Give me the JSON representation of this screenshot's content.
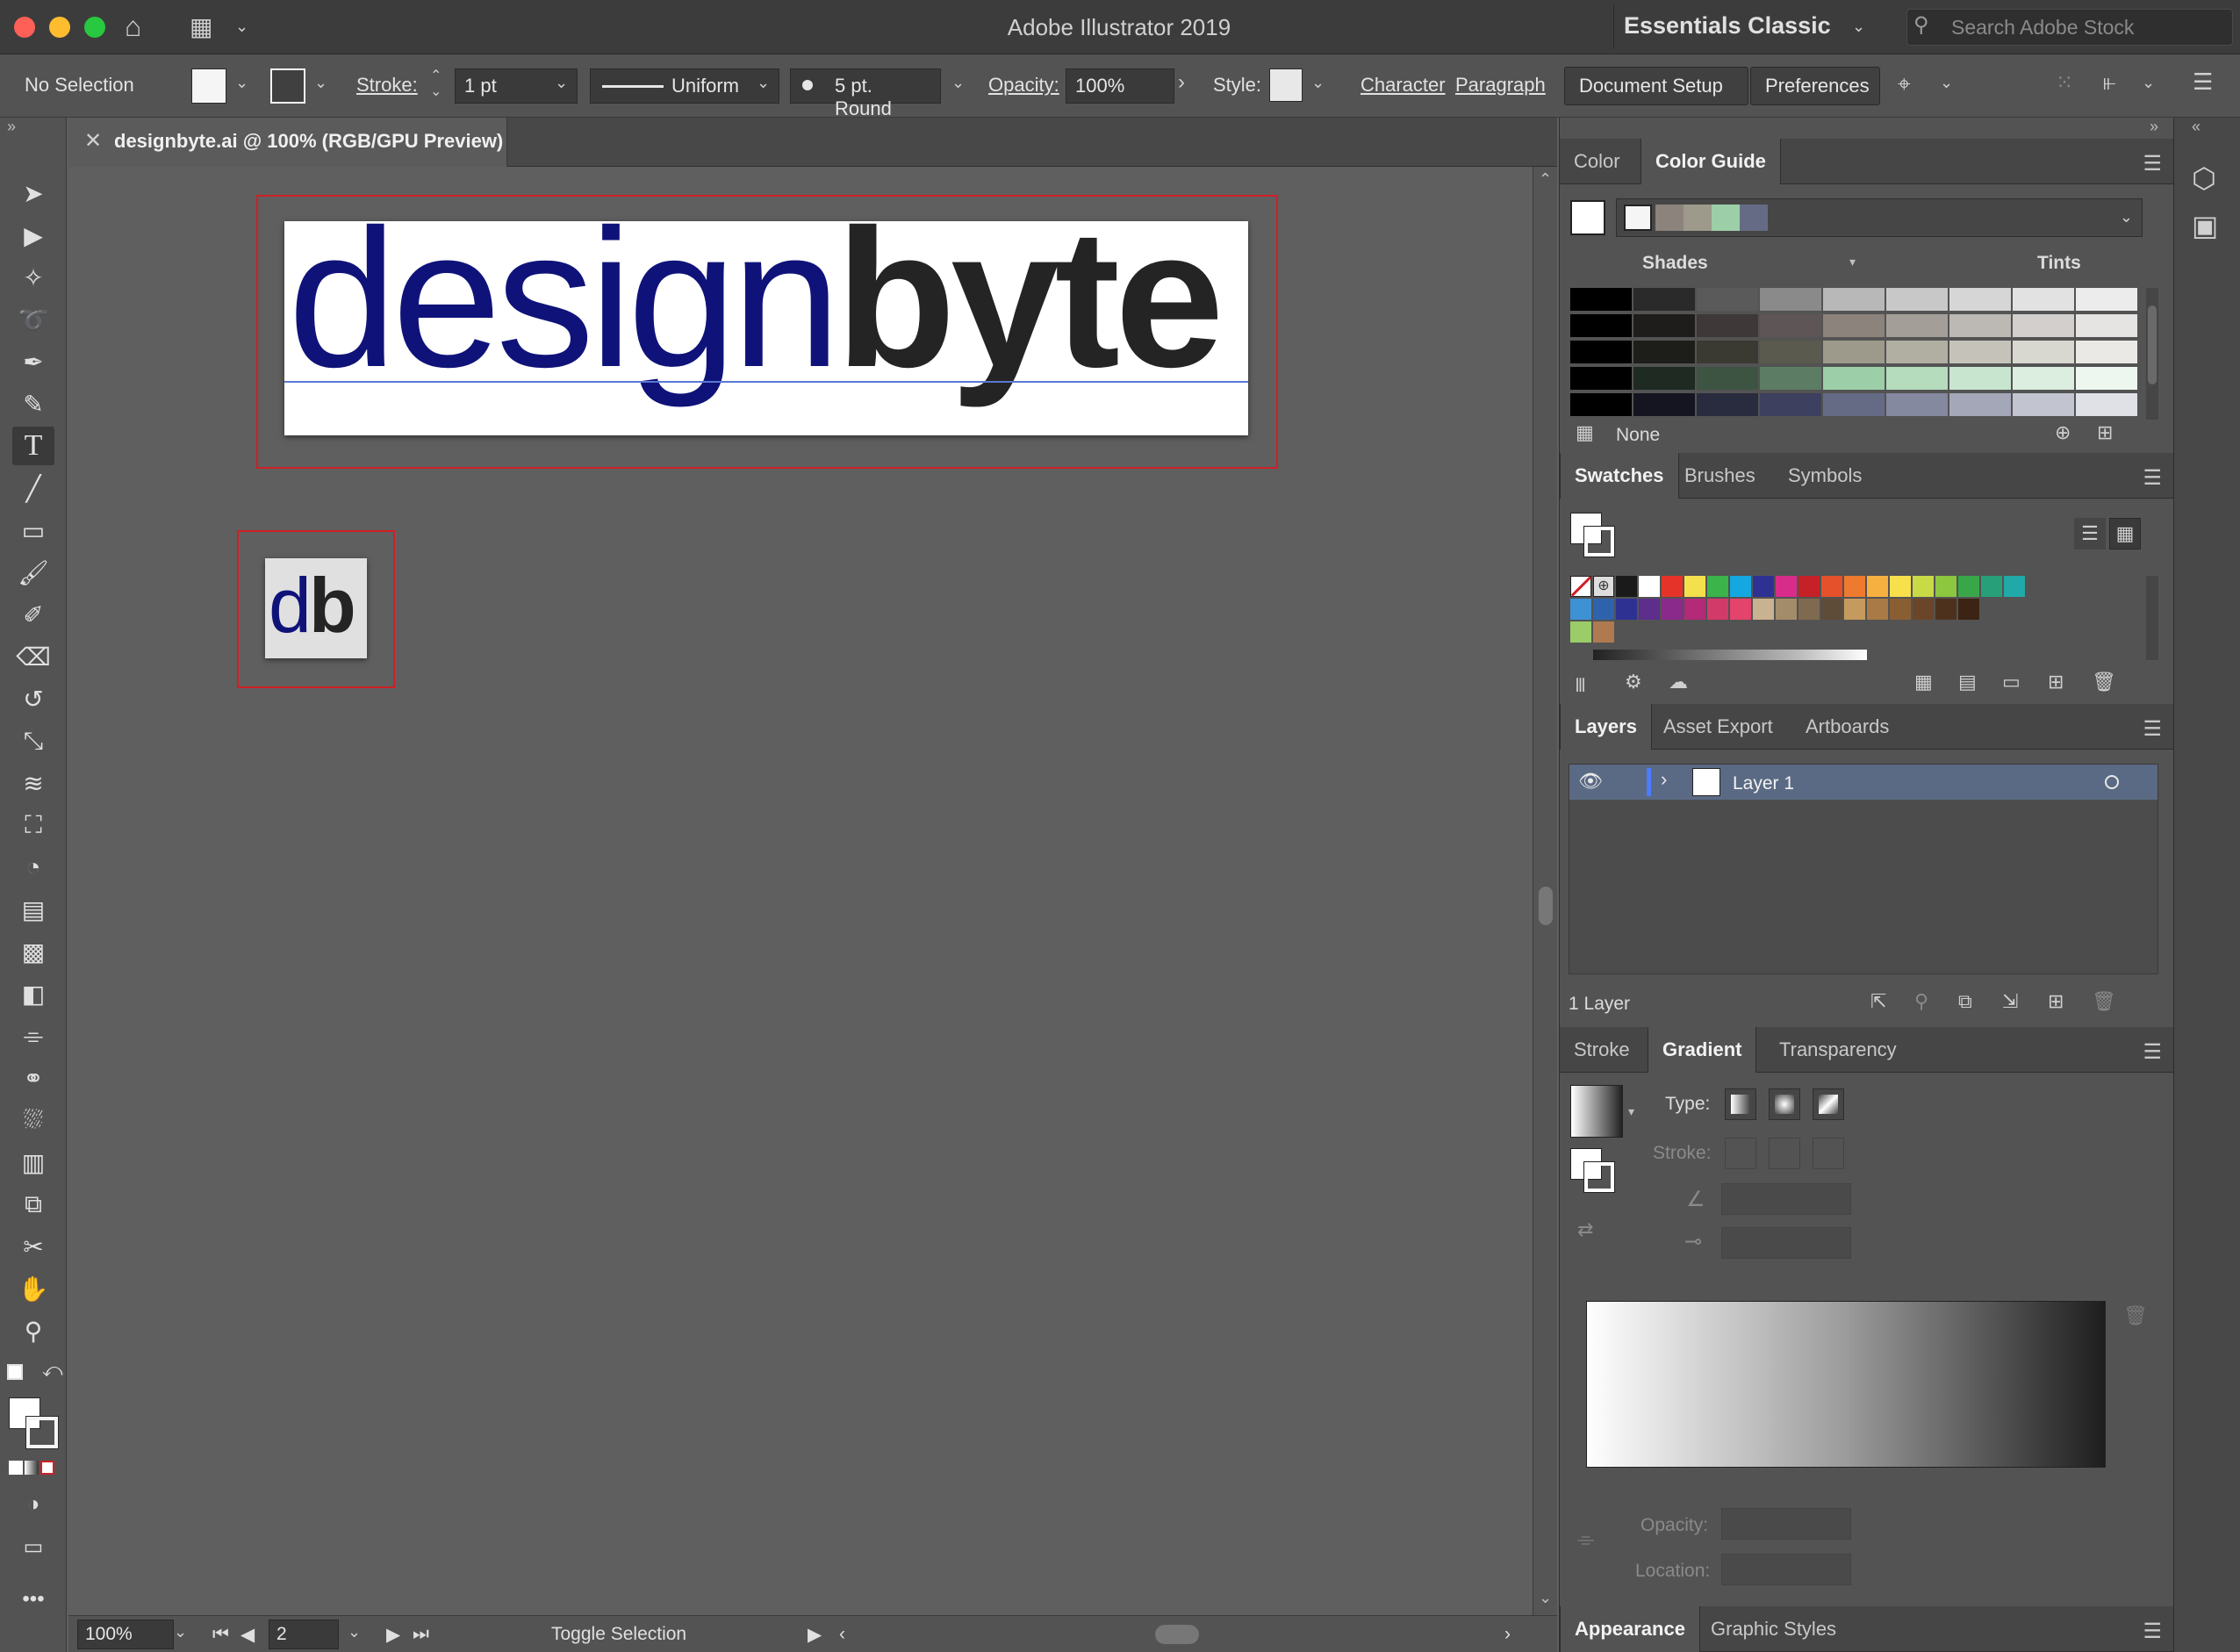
{
  "titlebar": {
    "app_title": "Adobe Illustrator 2019",
    "workspace": "Essentials Classic",
    "stock_search_placeholder": "Search Adobe Stock"
  },
  "controlbar": {
    "selection": "No Selection",
    "stroke_label": "Stroke:",
    "stroke_weight": "1 pt",
    "profile": "Uniform",
    "brush": "5 pt. Round",
    "opacity_label": "Opacity:",
    "opacity_value": "100%",
    "style_label": "Style:",
    "character": "Character",
    "paragraph": "Paragraph",
    "document_setup": "Document Setup",
    "preferences": "Preferences"
  },
  "document": {
    "tab_label": "designbyte.ai @ 100% (RGB/GPU Preview)",
    "logo_part1": "design",
    "logo_part2": "byte",
    "icon_part1": "d",
    "icon_part2": "b"
  },
  "statusbar": {
    "zoom": "100%",
    "artboard": "2",
    "status": "Toggle Selection"
  },
  "colorguide": {
    "tab_color": "Color",
    "tab_color_guide": "Color Guide",
    "shades": "Shades",
    "tints": "Tints",
    "none": "None",
    "harmony_colors": [
      "#f5f5f5",
      "#8b837c",
      "#9d9a8b",
      "#9ccfa8",
      "#666b85"
    ],
    "grid": [
      [
        "#000000",
        "#2a2a2a",
        "#5a5a5a",
        "#8a8a8a",
        "#b8b8b8",
        "#c8c8c8",
        "#d6d6d6",
        "#e2e2e2",
        "#ececec"
      ],
      [
        "#000000",
        "#1f1c1c",
        "#3e3838",
        "#5e5656",
        "#8b837c",
        "#a49e99",
        "#bcb8b4",
        "#d2cfcc",
        "#e6e4e2"
      ],
      [
        "#000000",
        "#1d1d1a",
        "#3a3a33",
        "#5a5a4f",
        "#9d9a8b",
        "#b1aea2",
        "#c5c3b9",
        "#d8d7d0",
        "#eae9e5"
      ],
      [
        "#000000",
        "#1e2a22",
        "#3d5443",
        "#5c7d64",
        "#9ccfa8",
        "#b4dcbd",
        "#c8e5cf",
        "#dbeee0",
        "#edf7ef"
      ],
      [
        "#000000",
        "#141520",
        "#292b3f",
        "#3e405f",
        "#666b85",
        "#85899f",
        "#a4a7b8",
        "#c2c4d0",
        "#e0e1e7"
      ]
    ]
  },
  "swatches": {
    "tabs": [
      "Swatches",
      "Brushes",
      "Symbols"
    ],
    "row1": [
      "#1a1a1a",
      "#ffffff",
      "#e63329",
      "#f4e04d",
      "#3bb44a",
      "#14a7e0",
      "#2e3192",
      "#d82c8b",
      "#c62127",
      "#e4512b",
      "#ee7a2f",
      "#f6b040",
      "#f7e04b",
      "#c8da46",
      "#8dc63f",
      "#3aa64a",
      "#27a07a",
      "#21a9a9"
    ],
    "row2": [
      "#3d91d4",
      "#2f62ad",
      "#2e3192",
      "#5d2e8c",
      "#8a2a8a",
      "#b22a78",
      "#d23a6a",
      "#e4436c",
      "#c9b28f",
      "#a38c6a",
      "#7f6a4f",
      "#5e4b38",
      "#c59a5e",
      "#a97a45",
      "#8a5e33",
      "#6b4527",
      "#4e311d",
      "#3b2414"
    ]
  },
  "layers": {
    "tabs": [
      "Layers",
      "Asset Export",
      "Artboards"
    ],
    "layer_name": "Layer 1",
    "count": "1 Layer"
  },
  "gradient": {
    "tabs": [
      "Stroke",
      "Gradient",
      "Transparency"
    ],
    "type_label": "Type:",
    "stroke_label": "Stroke:",
    "opacity_label": "Opacity:",
    "location_label": "Location:"
  },
  "appearance": {
    "tabs": [
      "Appearance",
      "Graphic Styles"
    ]
  }
}
